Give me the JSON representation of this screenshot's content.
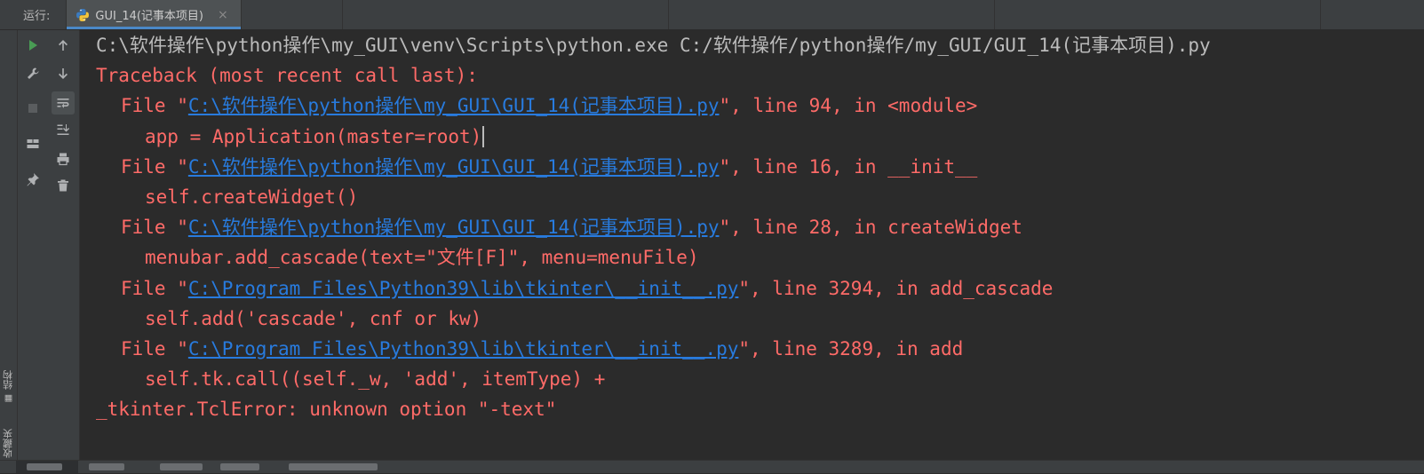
{
  "run_panel": {
    "label": "运行:",
    "tab": {
      "title": "GUI_14(记事本项目)",
      "close_symbol": "×",
      "icon": "python-icon"
    }
  },
  "left_strip": {
    "structure_label": "结构",
    "favorites_label": "收藏夹",
    "favorites_icon": "star-icon",
    "structure_icon": "structure-icon"
  },
  "toolbar": [
    {
      "name": "rerun-icon",
      "glyph": "▶",
      "color": "#499c54"
    },
    {
      "name": "wrench-icon"
    },
    {
      "name": "stop-icon",
      "glyph": "■"
    },
    {
      "name": "layout-icon"
    },
    {
      "name": "pin-icon"
    },
    {
      "name": "up-arrow-icon"
    },
    {
      "name": "down-arrow-icon"
    },
    {
      "name": "soft-wrap-icon",
      "active": true
    },
    {
      "name": "scroll-to-end-icon"
    },
    {
      "name": "print-icon"
    },
    {
      "name": "trash-icon"
    }
  ],
  "console": {
    "command": "C:\\软件操作\\python操作\\my_GUI\\venv\\Scripts\\python.exe C:/软件操作/python操作/my_GUI/GUI_14(记事本项目).py",
    "traceback_header": "Traceback (most recent call last):",
    "frames": [
      {
        "prefix": "File \"",
        "path": "C:\\软件操作\\python操作\\my_GUI\\GUI_14(记事本项目).py",
        "suffix": "\", line 94, in <module>",
        "code": "app = Application(master=root)"
      },
      {
        "prefix": "File \"",
        "path": "C:\\软件操作\\python操作\\my_GUI\\GUI_14(记事本项目).py",
        "suffix": "\", line 16, in __init__",
        "code": "self.createWidget()"
      },
      {
        "prefix": "File \"",
        "path": "C:\\软件操作\\python操作\\my_GUI\\GUI_14(记事本项目).py",
        "suffix": "\", line 28, in createWidget",
        "code": "menubar.add_cascade(text=\"文件[F]\", menu=menuFile)"
      },
      {
        "prefix": "File \"",
        "path": "C:\\Program Files\\Python39\\lib\\tkinter\\__init__.py",
        "suffix": "\", line 3294, in add_cascade",
        "code": "self.add('cascade', cnf or kw)"
      },
      {
        "prefix": "File \"",
        "path": "C:\\Program Files\\Python39\\lib\\tkinter\\__init__.py",
        "suffix": "\", line 3289, in add",
        "code": "self.tk.call((self._w, 'add', itemType) +"
      }
    ],
    "error": "_tkinter.TclError: unknown option \"-text\""
  },
  "colors": {
    "error": "#ff6b68",
    "link": "#287bde",
    "text": "#bbbbbb",
    "background": "#2b2b2b",
    "panel": "#3c3f41"
  }
}
